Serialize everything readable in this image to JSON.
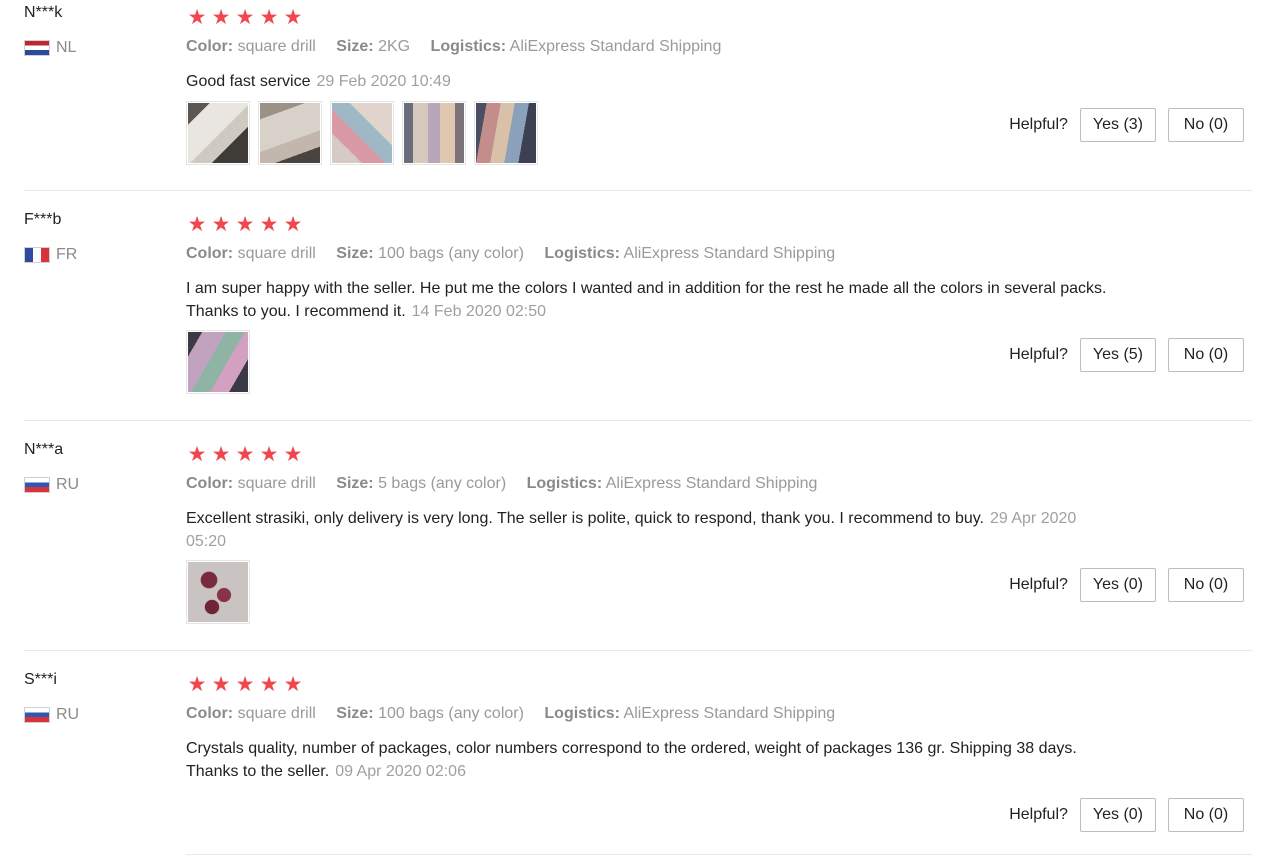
{
  "labels": {
    "color": "Color:",
    "size": "Size:",
    "logistics": "Logistics:",
    "helpful": "Helpful?"
  },
  "reviews": [
    {
      "user": "N***k",
      "country": "NL",
      "rating": 5,
      "color": "square drill",
      "size": "2KG",
      "logistics": "AliExpress Standard Shipping",
      "text": "Good fast service",
      "date": "29 Feb 2020 10:49",
      "photos": [
        "photo-1",
        "photo-2",
        "photo-3",
        "photo-4",
        "photo-5"
      ],
      "yes": "Yes (3)",
      "no": "No (0)"
    },
    {
      "user": "F***b",
      "country": "FR",
      "rating": 5,
      "color": "square drill",
      "size": "100 bags (any color)",
      "logistics": "AliExpress Standard Shipping",
      "text": "I am super happy with the seller. He put me the colors I wanted and in addition for the rest he made all the colors in several packs. Thanks to you. I recommend it.",
      "date": "14 Feb 2020 02:50",
      "photos": [
        "photo-1"
      ],
      "yes": "Yes (5)",
      "no": "No (0)"
    },
    {
      "user": "N***a",
      "country": "RU",
      "rating": 5,
      "color": "square drill",
      "size": "5 bags (any color)",
      "logistics": "AliExpress Standard Shipping",
      "text": "Excellent strasiki, only delivery is very long. The seller is polite, quick to respond, thank you. I recommend to buy.",
      "date": "29 Apr 2020 05:20",
      "photos": [
        "photo-1"
      ],
      "yes": "Yes (0)",
      "no": "No (0)"
    },
    {
      "user": "S***i",
      "country": "RU",
      "rating": 5,
      "color": "square drill",
      "size": "100 bags (any color)",
      "logistics": "AliExpress Standard Shipping",
      "text": "Crystals quality, number of packages, color numbers correspond to the ordered, weight of packages 136 gr. Shipping 38 days. Thanks to the seller.",
      "date": "09 Apr 2020 02:06",
      "photos": [],
      "yes": "Yes (0)",
      "no": "No (0)"
    }
  ]
}
